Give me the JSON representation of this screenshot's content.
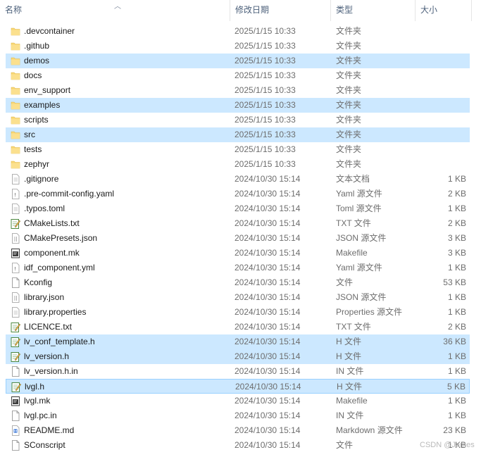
{
  "columns": {
    "name": "名称",
    "modified": "修改日期",
    "type": "类型",
    "size": "大小"
  },
  "files": [
    {
      "name": ".devcontainer",
      "modified": "2025/1/15 10:33",
      "type": "文件夹",
      "size": "",
      "icon": "folder-icon",
      "selected": false
    },
    {
      "name": ".github",
      "modified": "2025/1/15 10:33",
      "type": "文件夹",
      "size": "",
      "icon": "folder-icon",
      "selected": false
    },
    {
      "name": "demos",
      "modified": "2025/1/15 10:33",
      "type": "文件夹",
      "size": "",
      "icon": "folder-icon",
      "selected": true
    },
    {
      "name": "docs",
      "modified": "2025/1/15 10:33",
      "type": "文件夹",
      "size": "",
      "icon": "folder-icon",
      "selected": false
    },
    {
      "name": "env_support",
      "modified": "2025/1/15 10:33",
      "type": "文件夹",
      "size": "",
      "icon": "folder-icon",
      "selected": false
    },
    {
      "name": "examples",
      "modified": "2025/1/15 10:33",
      "type": "文件夹",
      "size": "",
      "icon": "folder-icon",
      "selected": true
    },
    {
      "name": "scripts",
      "modified": "2025/1/15 10:33",
      "type": "文件夹",
      "size": "",
      "icon": "folder-icon",
      "selected": false
    },
    {
      "name": "src",
      "modified": "2025/1/15 10:33",
      "type": "文件夹",
      "size": "",
      "icon": "folder-icon",
      "selected": true
    },
    {
      "name": "tests",
      "modified": "2025/1/15 10:33",
      "type": "文件夹",
      "size": "",
      "icon": "folder-icon",
      "selected": false
    },
    {
      "name": "zephyr",
      "modified": "2025/1/15 10:33",
      "type": "文件夹",
      "size": "",
      "icon": "folder-icon",
      "selected": false
    },
    {
      "name": ".gitignore",
      "modified": "2024/10/30 15:14",
      "type": "文本文档",
      "size": "1 KB",
      "icon": "text-document-icon",
      "selected": false
    },
    {
      "name": ".pre-commit-config.yaml",
      "modified": "2024/10/30 15:14",
      "type": "Yaml 源文件",
      "size": "2 KB",
      "icon": "yaml-file-icon",
      "selected": false
    },
    {
      "name": ".typos.toml",
      "modified": "2024/10/30 15:14",
      "type": "Toml 源文件",
      "size": "1 KB",
      "icon": "text-document-icon",
      "selected": false
    },
    {
      "name": "CMakeLists.txt",
      "modified": "2024/10/30 15:14",
      "type": "TXT 文件",
      "size": "2 KB",
      "icon": "edit-document-icon",
      "selected": false
    },
    {
      "name": "CMakePresets.json",
      "modified": "2024/10/30 15:14",
      "type": "JSON 源文件",
      "size": "3 KB",
      "icon": "json-file-icon",
      "selected": false
    },
    {
      "name": "component.mk",
      "modified": "2024/10/30 15:14",
      "type": "Makefile",
      "size": "3 KB",
      "icon": "makefile-icon",
      "selected": false
    },
    {
      "name": "idf_component.yml",
      "modified": "2024/10/30 15:14",
      "type": "Yaml 源文件",
      "size": "1 KB",
      "icon": "yaml-file-icon",
      "selected": false
    },
    {
      "name": "Kconfig",
      "modified": "2024/10/30 15:14",
      "type": "文件",
      "size": "53 KB",
      "icon": "blank-file-icon",
      "selected": false
    },
    {
      "name": "library.json",
      "modified": "2024/10/30 15:14",
      "type": "JSON 源文件",
      "size": "1 KB",
      "icon": "json-file-icon",
      "selected": false
    },
    {
      "name": "library.properties",
      "modified": "2024/10/30 15:14",
      "type": "Properties 源文件",
      "size": "1 KB",
      "icon": "text-document-icon",
      "selected": false
    },
    {
      "name": "LICENCE.txt",
      "modified": "2024/10/30 15:14",
      "type": "TXT 文件",
      "size": "2 KB",
      "icon": "edit-document-icon",
      "selected": false
    },
    {
      "name": "lv_conf_template.h",
      "modified": "2024/10/30 15:14",
      "type": "H 文件",
      "size": "36 KB",
      "icon": "edit-document-icon",
      "selected": true
    },
    {
      "name": "lv_version.h",
      "modified": "2024/10/30 15:14",
      "type": "H 文件",
      "size": "1 KB",
      "icon": "edit-document-icon",
      "selected": true
    },
    {
      "name": "lv_version.h.in",
      "modified": "2024/10/30 15:14",
      "type": "IN 文件",
      "size": "1 KB",
      "icon": "blank-file-icon",
      "selected": false
    },
    {
      "name": "lvgl.h",
      "modified": "2024/10/30 15:14",
      "type": "H 文件",
      "size": "5 KB",
      "icon": "edit-document-icon",
      "selected": true,
      "focused": true
    },
    {
      "name": "lvgl.mk",
      "modified": "2024/10/30 15:14",
      "type": "Makefile",
      "size": "1 KB",
      "icon": "makefile-icon",
      "selected": false
    },
    {
      "name": "lvgl.pc.in",
      "modified": "2024/10/30 15:14",
      "type": "IN 文件",
      "size": "1 KB",
      "icon": "blank-file-icon",
      "selected": false
    },
    {
      "name": "README.md",
      "modified": "2024/10/30 15:14",
      "type": "Markdown 源文件",
      "size": "23 KB",
      "icon": "markdown-file-icon",
      "selected": false
    },
    {
      "name": "SConscript",
      "modified": "2024/10/30 15:14",
      "type": "文件",
      "size": "1 KB",
      "icon": "blank-file-icon",
      "selected": false
    }
  ],
  "watermark": "CSDN @James",
  "colors": {
    "selection": "#cce8ff",
    "selection_border": "#99d1ff",
    "folder": "#f8d775"
  }
}
